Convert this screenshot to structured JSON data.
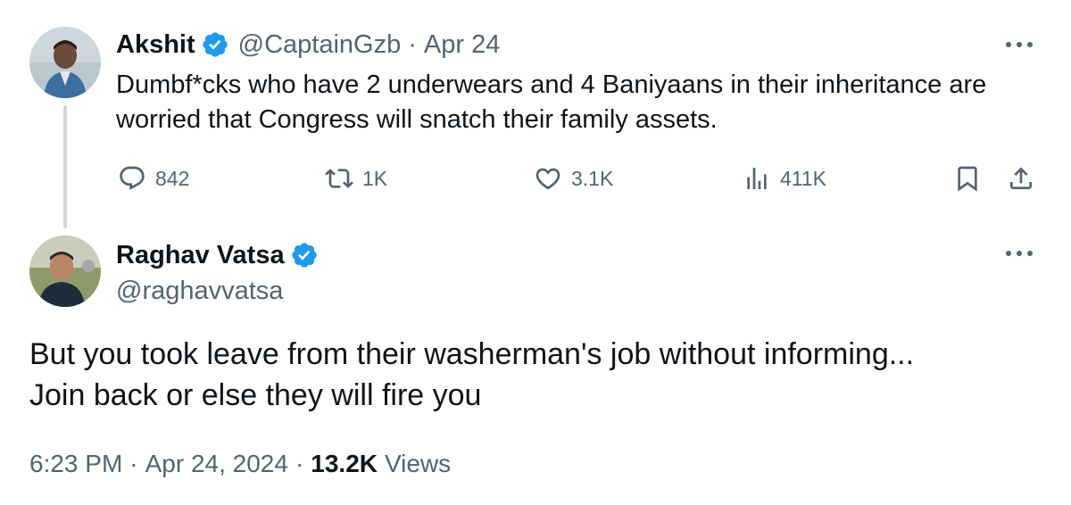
{
  "parent": {
    "name": "Akshit",
    "handle": "@CaptainGzb",
    "separator": "·",
    "date": "Apr 24",
    "text": "Dumbf*cks who have 2 underwears and 4 Baniyaans in their inheritance are worried that Congress will snatch their family assets.",
    "metrics": {
      "replies": "842",
      "reposts": "1K",
      "likes": "3.1K",
      "views": "411K"
    },
    "icons": {
      "reply": "reply-icon",
      "repost": "repost-icon",
      "like": "heart-icon",
      "views": "views-chart-icon",
      "bookmark": "bookmark-icon",
      "share": "share-icon",
      "more": "more-dots-icon"
    }
  },
  "reply": {
    "name": "Raghav Vatsa",
    "handle": "@raghavvatsa",
    "text_line1": "But you took leave from their washerman's job without informing...",
    "text_line2": "Join back or else they will fire you",
    "time": "6:23 PM",
    "separator1": "·",
    "date": "Apr 24, 2024",
    "separator2": "·",
    "views_count": "13.2K",
    "views_label": "Views"
  },
  "colors": {
    "verified_blue": "#1d9bf0",
    "text_primary": "#0f1419",
    "text_secondary": "#536471",
    "thread_line": "#cfd9de"
  }
}
